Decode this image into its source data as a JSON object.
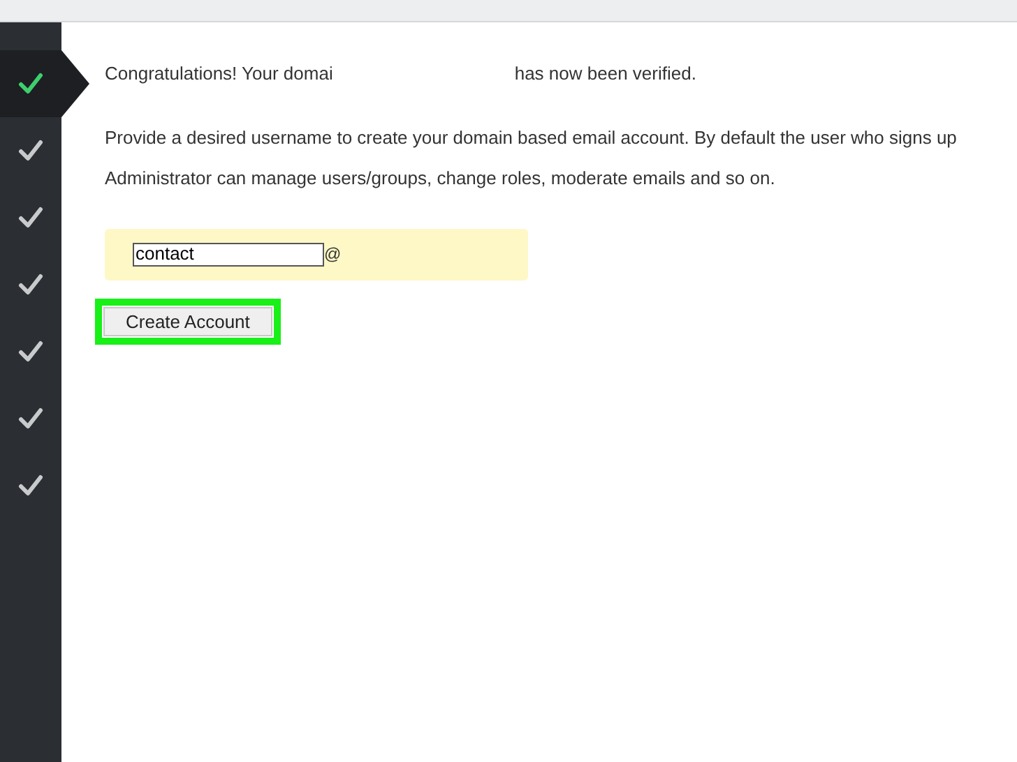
{
  "steps": [
    {
      "selected": true
    },
    {
      "selected": false
    },
    {
      "selected": false
    },
    {
      "selected": false
    },
    {
      "selected": false
    },
    {
      "selected": false
    },
    {
      "selected": false
    }
  ],
  "message": {
    "before": "Congratulations! Your domai",
    "after": "has now been verified."
  },
  "description": [
    "Provide a desired username to create your domain based email account. By default the user who signs up",
    "Administrator can manage users/groups, change roles, moderate emails and so on."
  ],
  "username_field": {
    "value": "contact",
    "suffix": "@"
  },
  "create_button": {
    "label": "Create Account",
    "highlighted": true
  }
}
